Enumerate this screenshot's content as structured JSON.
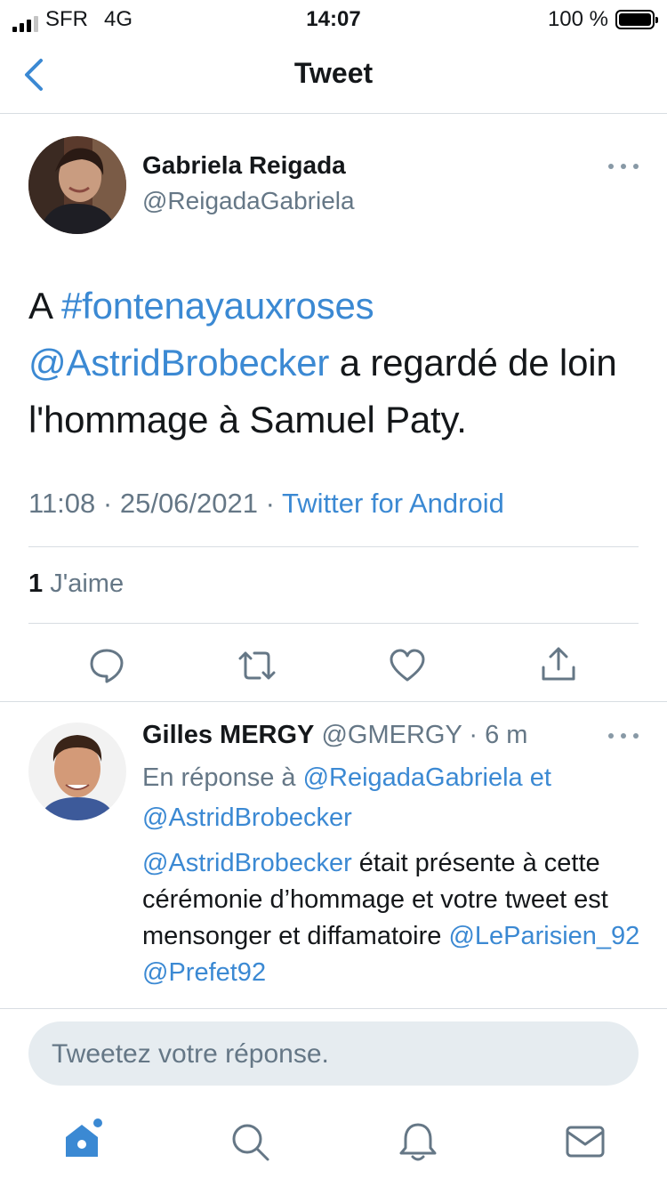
{
  "status_bar": {
    "carrier": "SFR",
    "network": "4G",
    "time": "14:07",
    "battery": "100 %",
    "battery_level": 1.0
  },
  "nav": {
    "title": "Tweet",
    "back_icon": "chevron-left-icon"
  },
  "tweet": {
    "author_name": "Gabriela Reigada",
    "author_handle": "@ReigadaGabriela",
    "text_prefix": "A ",
    "hashtag": "#fontenayauxroses",
    "mention": "@AstridBrobecker",
    "text_rest": " a regardé de loin l'hommage à Samuel Paty.",
    "time": "11:08",
    "date": "25/06/2021",
    "separator": " · ",
    "source": "Twitter for Android",
    "like_count": "1",
    "like_label": " J'aime",
    "actions": [
      "reply-icon",
      "retweet-icon",
      "like-icon",
      "share-icon"
    ]
  },
  "reply": {
    "author_name": "Gilles MERGY",
    "author_handle": "@GMERGY",
    "time_sep": " · ",
    "time_ago": "6 m",
    "reply_prefix": "En réponse à ",
    "reply_user1": "@ReigadaGabriela",
    "reply_and": " et",
    "reply_user2": "@AstridBrobecker",
    "text_mention": "@AstridBrobecker",
    "text_body": " était présente à cette cérémonie d’hommage et votre tweet est mensonger et diffamatoire ",
    "text_mention2": "@LeParisien_92",
    "text_mention3": "@Prefet92"
  },
  "compose": {
    "placeholder": "Tweetez votre réponse."
  },
  "tab_bar": {
    "items": [
      "home-icon",
      "search-icon",
      "notifications-icon",
      "messages-icon"
    ]
  },
  "colors": {
    "link": "#3b89d3",
    "muted": "#657786",
    "divider": "#d8dde2"
  }
}
